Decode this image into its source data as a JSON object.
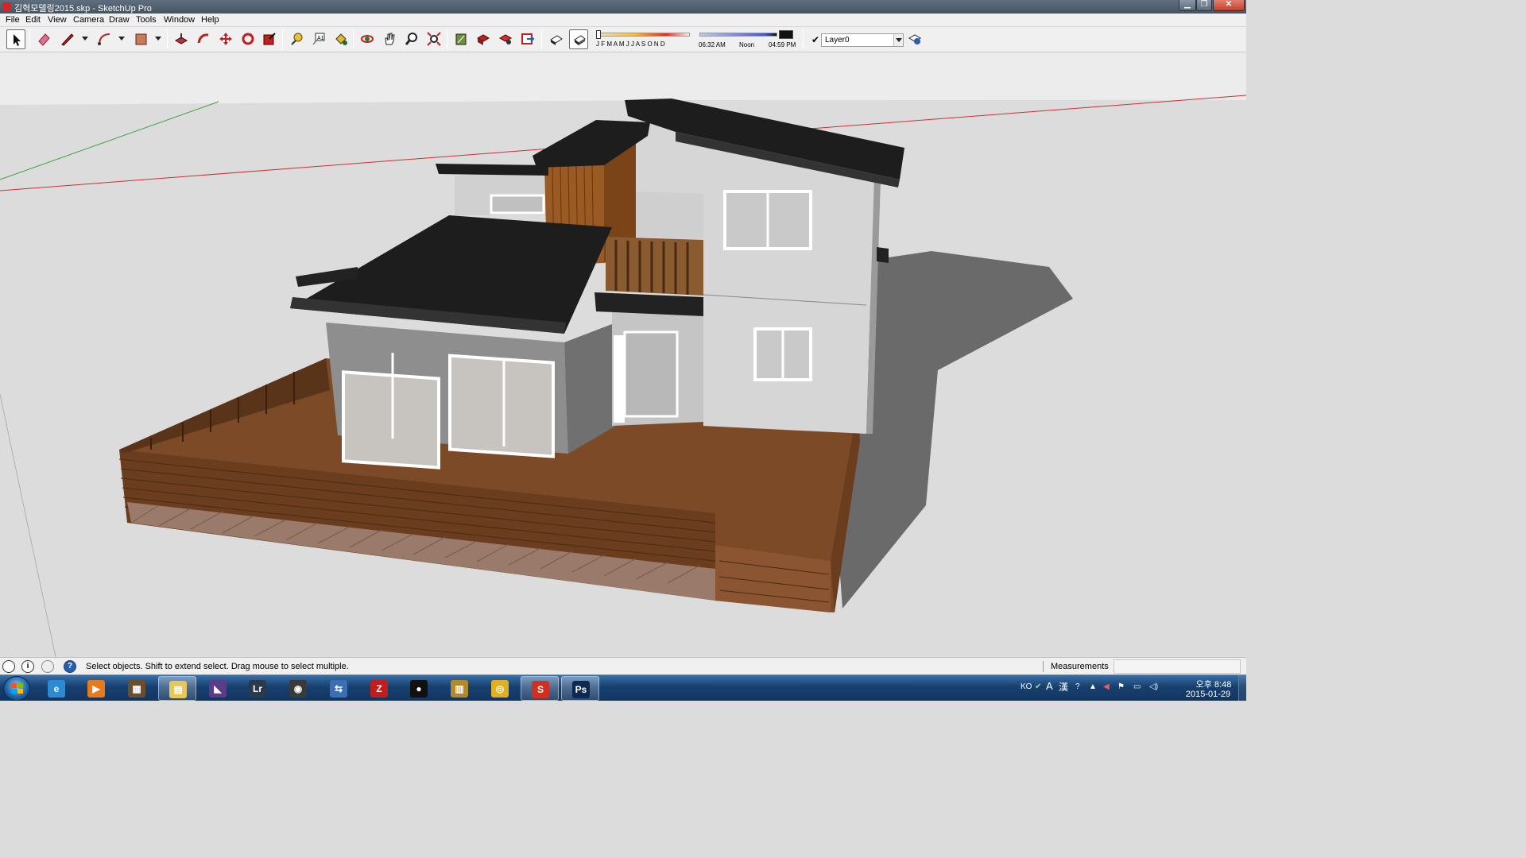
{
  "window": {
    "title": "김혁모델링2015.skp - SketchUp Pro",
    "minimize_icon": "minimize-icon",
    "maximize_icon": "maximize-icon",
    "close_icon": "close-icon"
  },
  "menu": {
    "items": [
      "File",
      "Edit",
      "View",
      "Camera",
      "Draw",
      "Tools",
      "Window",
      "Help"
    ]
  },
  "toolbar": {
    "tools": [
      {
        "name": "select-tool",
        "icon": "arrow-cursor-icon",
        "active": true
      },
      {
        "name": "eraser-tool",
        "icon": "eraser-icon"
      },
      {
        "name": "line-tool",
        "icon": "pencil-icon"
      },
      {
        "name": "arc-tool",
        "icon": "arc-icon"
      },
      {
        "name": "rectangle-tool",
        "icon": "rectangle-icon"
      },
      {
        "name": "push-pull-tool",
        "icon": "push-pull-icon"
      },
      {
        "name": "follow-me-tool",
        "icon": "follow-me-icon"
      },
      {
        "name": "move-tool",
        "icon": "move-icon"
      },
      {
        "name": "rotate-tool",
        "icon": "rotate-icon"
      },
      {
        "name": "scale-tool",
        "icon": "scale-icon"
      },
      {
        "name": "tape-measure-tool",
        "icon": "tape-measure-icon"
      },
      {
        "name": "text-tool",
        "icon": "text-icon"
      },
      {
        "name": "paint-bucket-tool",
        "icon": "paint-bucket-icon"
      },
      {
        "name": "orbit-tool",
        "icon": "orbit-icon"
      },
      {
        "name": "pan-tool",
        "icon": "hand-icon"
      },
      {
        "name": "zoom-tool",
        "icon": "magnifier-icon"
      },
      {
        "name": "zoom-extents-tool",
        "icon": "zoom-extents-icon"
      },
      {
        "name": "3d-warehouse-tool",
        "icon": "warehouse-icon"
      },
      {
        "name": "share-model-tool",
        "icon": "share-model-icon"
      },
      {
        "name": "share-component-tool",
        "icon": "share-component-icon"
      },
      {
        "name": "extension-warehouse-tool",
        "icon": "extension-warehouse-icon"
      },
      {
        "name": "display-shadows-tool",
        "icon": "shadow-settings-icon"
      },
      {
        "name": "display-shadows-toggle",
        "icon": "shadows-toggle-icon",
        "active": true
      }
    ],
    "shadow_months": "J F M A M J J A S O N D",
    "shadow_time_start": "06:32 AM",
    "shadow_time_mid": "Noon",
    "shadow_time_end": "04:59 PM",
    "layer_name": "Layer0",
    "layer_check_icon": "checkmark-icon",
    "layer_manager_icon": "layer-manager-icon"
  },
  "status": {
    "icons": [
      "geo-location-icon",
      "credits-icon",
      "user-icon",
      "help-icon"
    ],
    "help_glyph": "?",
    "credits_glyph": "i",
    "text": "Select objects. Shift to extend select. Drag mouse to select multiple.",
    "measurements_label": "Measurements",
    "measurements_value": ""
  },
  "taskbar": {
    "start_icon": "windows-start-icon",
    "apps": [
      {
        "name": "internet-explorer",
        "icon": "ie-icon",
        "label": "e",
        "color": "#2a8ad4"
      },
      {
        "name": "media-player",
        "icon": "media-player-icon",
        "label": "▶",
        "color": "#e87a1e"
      },
      {
        "name": "photo-viewer",
        "icon": "photo-viewer-icon",
        "label": "▦",
        "color": "#6b4e2e"
      },
      {
        "name": "file-explorer",
        "icon": "folder-icon",
        "label": "▤",
        "color": "#e8c65a",
        "open": true
      },
      {
        "name": "visual-studio",
        "icon": "visual-studio-icon",
        "label": "◣",
        "color": "#5a3d8a"
      },
      {
        "name": "lightroom",
        "icon": "lightroom-icon",
        "label": "Lr",
        "color": "#2b3a4a"
      },
      {
        "name": "camera-app",
        "icon": "camera-icon",
        "label": "◉",
        "color": "#3a3a3a"
      },
      {
        "name": "network-app",
        "icon": "network-icon",
        "label": "⇆",
        "color": "#3b6fb5"
      },
      {
        "name": "filezilla",
        "icon": "filezilla-icon",
        "label": "Z",
        "color": "#c21d1d"
      },
      {
        "name": "qq",
        "icon": "penguin-icon",
        "label": "●",
        "color": "#111111"
      },
      {
        "name": "archive-app",
        "icon": "archive-icon",
        "label": "▥",
        "color": "#b38a2a"
      },
      {
        "name": "chrome",
        "icon": "chrome-icon",
        "label": "◎",
        "color": "#e0b020"
      },
      {
        "name": "sketchup",
        "icon": "sketchup-icon",
        "label": "S",
        "color": "#d0301f",
        "open": true
      },
      {
        "name": "photoshop",
        "icon": "photoshop-icon",
        "label": "Ps",
        "color": "#0c2a52",
        "open": true
      }
    ],
    "tray": {
      "lang": "KO",
      "ime_a": "A",
      "ime_han": "漢",
      "icons": [
        "ime-icon",
        "help-tray-icon",
        "up-arrow-icon",
        "volume-muted-icon",
        "flag-icon",
        "network-tray-icon",
        "speaker-icon"
      ],
      "time": "오후 8:48",
      "date": "2015-01-29"
    }
  }
}
